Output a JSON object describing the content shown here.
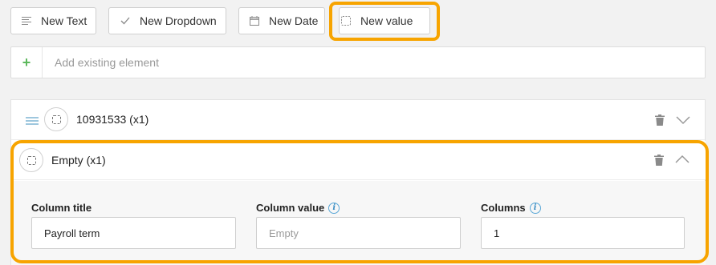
{
  "toolbar": {
    "new_text": "New Text",
    "new_dropdown": "New Dropdown",
    "new_date": "New Date",
    "new_value": "New value"
  },
  "add_existing": {
    "icon": "+",
    "placeholder": "Add existing element"
  },
  "elements": [
    {
      "title": "10931533 (x1)",
      "expanded": false
    },
    {
      "title": "Empty (x1)",
      "expanded": true
    }
  ],
  "detail": {
    "column_title_label": "Column title",
    "column_title_value": "Payroll term",
    "column_value_label": "Column value",
    "column_value_placeholder": "Empty",
    "columns_label": "Columns",
    "columns_value": "1",
    "info_glyph": "i"
  },
  "colors": {
    "highlight": "#f7a400",
    "add_plus": "#5cb85c",
    "info": "#3d8fc4"
  }
}
